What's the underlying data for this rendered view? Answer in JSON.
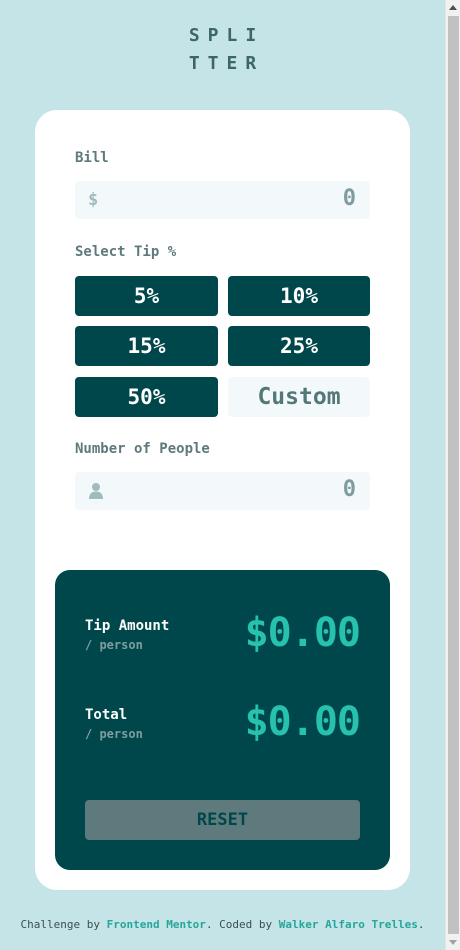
{
  "logo": {
    "line1": "SPLI",
    "line2": "TTER"
  },
  "bill": {
    "label": "Bill",
    "prefix": "$",
    "value": "0"
  },
  "tip": {
    "label": "Select Tip %",
    "options": [
      "5%",
      "10%",
      "15%",
      "25%",
      "50%"
    ],
    "custom_placeholder": "Custom"
  },
  "people": {
    "label": "Number of People",
    "value": "0"
  },
  "results": {
    "tip_label": "Tip Amount",
    "tip_sub": "/ person",
    "tip_value": "$0.00",
    "total_label": "Total",
    "total_sub": "/ person",
    "total_value": "$0.00",
    "reset_label": "RESET"
  },
  "footer": {
    "prefix": "Challenge by ",
    "link1": "Frontend Mentor",
    "middle": ". Coded by ",
    "link2": "Walker Alfaro Trelles",
    "suffix": "."
  },
  "colors": {
    "background": "#c5e4e7",
    "dark_cyan": "#00474b",
    "accent": "#26c2ae"
  }
}
